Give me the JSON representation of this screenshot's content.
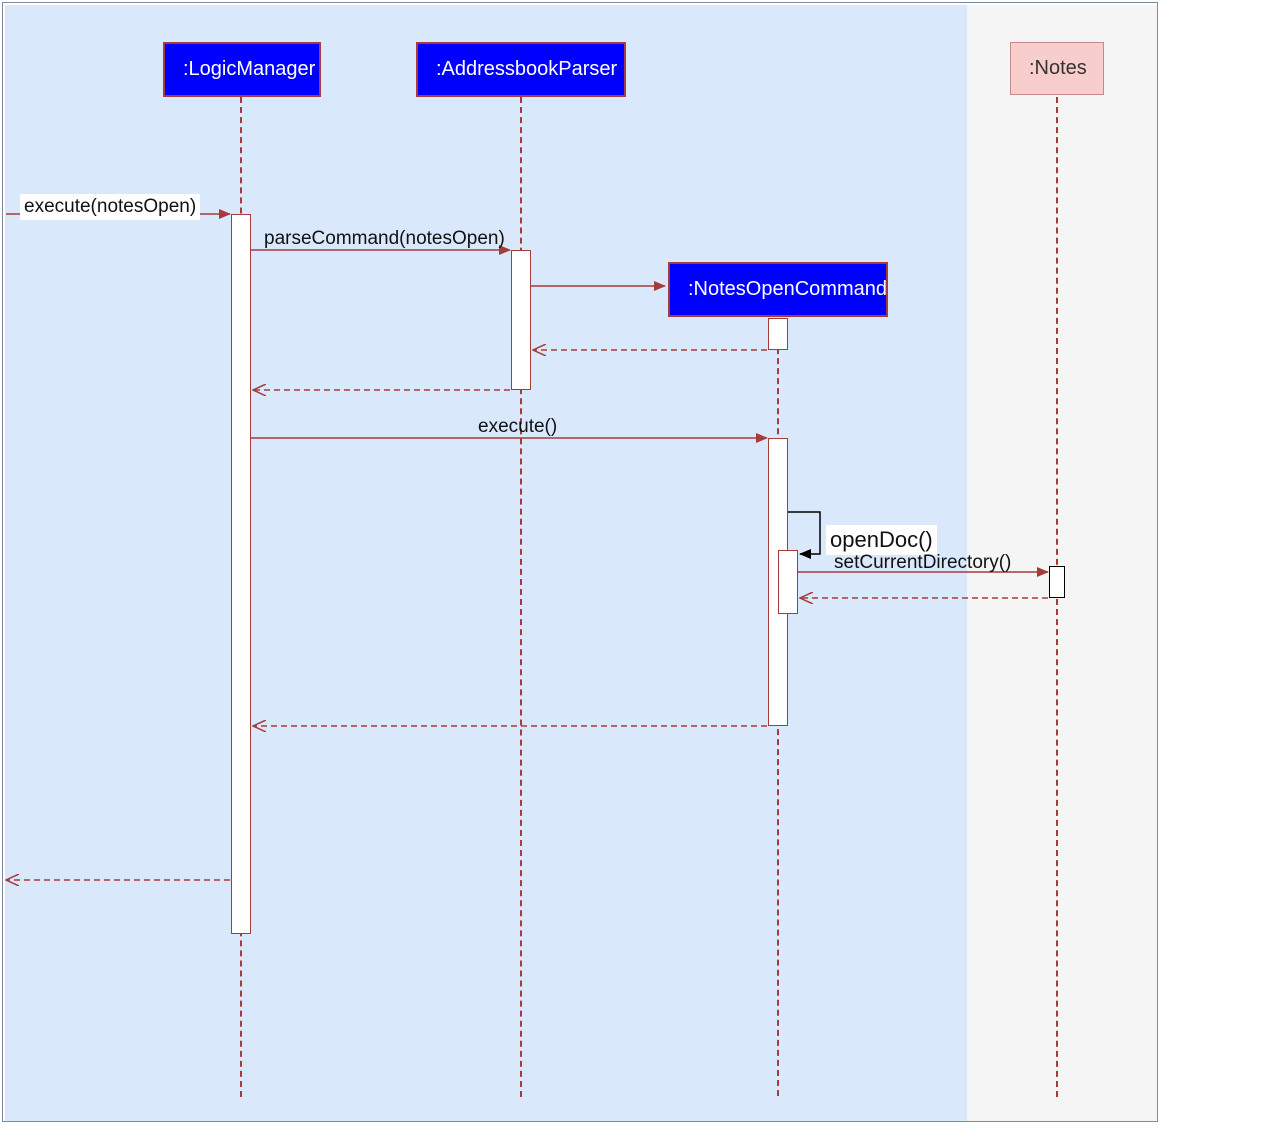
{
  "diagram": {
    "type": "sequence",
    "title": "",
    "participants": {
      "logicManager": ":LogicManager",
      "addressbookParser": ":AddressbookParser",
      "notesOpenCommand": ":NotesOpenCommand",
      "notes": ":Notes"
    },
    "messages": {
      "executeIn": "execute(notesOpen)",
      "parseCommand": "parseCommand(notesOpen)",
      "executeCall": "execute()",
      "openDoc": "openDoc()",
      "setCurrentDirectory": "setCurrentDirectory()"
    },
    "sequence": [
      {
        "from": "external",
        "to": "logicManager",
        "label": "execute(notesOpen)",
        "kind": "sync"
      },
      {
        "from": "logicManager",
        "to": "addressbookParser",
        "label": "parseCommand(notesOpen)",
        "kind": "sync"
      },
      {
        "from": "addressbookParser",
        "to": "notesOpenCommand",
        "label": "",
        "kind": "create"
      },
      {
        "from": "notesOpenCommand",
        "to": "addressbookParser",
        "label": "",
        "kind": "return"
      },
      {
        "from": "addressbookParser",
        "to": "logicManager",
        "label": "",
        "kind": "return"
      },
      {
        "from": "logicManager",
        "to": "notesOpenCommand",
        "label": "execute()",
        "kind": "sync"
      },
      {
        "from": "notesOpenCommand",
        "to": "notesOpenCommand",
        "label": "openDoc()",
        "kind": "self"
      },
      {
        "from": "notesOpenCommand",
        "to": "notes",
        "label": "setCurrentDirectory()",
        "kind": "sync"
      },
      {
        "from": "notes",
        "to": "notesOpenCommand",
        "label": "",
        "kind": "return"
      },
      {
        "from": "notesOpenCommand",
        "to": "logicManager",
        "label": "",
        "kind": "return"
      },
      {
        "from": "logicManager",
        "to": "external",
        "label": "",
        "kind": "return"
      }
    ]
  }
}
